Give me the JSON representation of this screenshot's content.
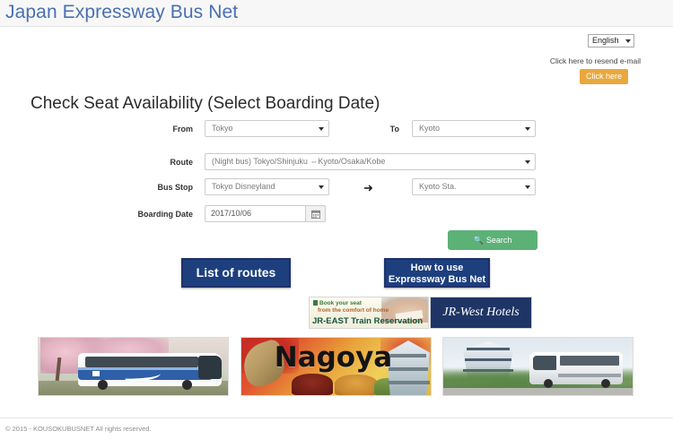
{
  "header": {
    "site_title": "Japan Expressway Bus Net"
  },
  "topbar": {
    "language_selected": "English",
    "resend_email_text": "Click here to resend e-mail",
    "click_here_label": "Click here",
    "click_here_color": "#eaa83c"
  },
  "main": {
    "heading": "Check Seat Availability (Select Boarding Date)",
    "fields": {
      "from_label": "From",
      "from_value": "Tokyo",
      "to_label": "To",
      "to_value": "Kyoto",
      "route_label": "Route",
      "route_value": "(Night bus) Tokyo/Shinjuku ⇔Kyoto/Osaka/Kobe",
      "busstop_label": "Bus Stop",
      "busstop_from_value": "Tokyo Disneyland",
      "busstop_arrow": "➜",
      "busstop_to_value": "Kyoto Sta.",
      "boarding_date_label": "Boarding Date",
      "boarding_date_value": "2017/10/06",
      "calendar_icon": "calendar-icon"
    },
    "search_button": {
      "label": "Search",
      "icon": "search-icon",
      "color": "#5cb177"
    },
    "nav_buttons": {
      "list_of_routes": "List of routes",
      "how_to_use_line1": "How to use",
      "how_to_use_line2": "Expressway Bus Net",
      "color": "#1d3f7e"
    }
  },
  "banners": {
    "jr_east": {
      "line1": "Book your seat",
      "line2": "from the comfort of home",
      "title": "JR-EAST Train Reservation"
    },
    "jr_west": {
      "title": "JR-West Hotels",
      "color": "#1f3566"
    }
  },
  "promos": {
    "promo_1_alt": "Express bus with cherry blossoms",
    "promo_2_alt": "Nagoya",
    "promo_3_alt": "Express bus with Japanese castle"
  },
  "footer": {
    "copyright": "© 2015 - KOUSOKUBUSNET All rights reserved."
  }
}
